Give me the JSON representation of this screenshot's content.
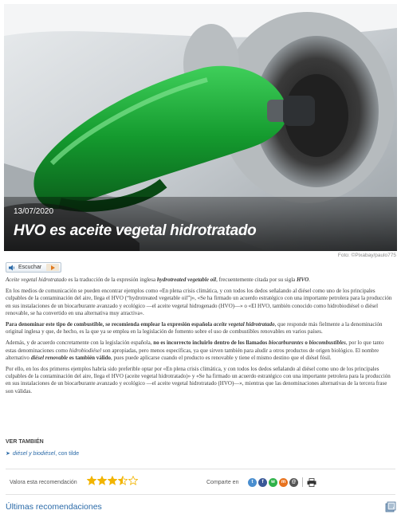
{
  "hero": {
    "date": "13/07/2020",
    "title": "HVO es aceite vegetal hidrotratado"
  },
  "image_credit": "Foto: ©Pixabay/paulo775",
  "listen": {
    "label": "Escuchar"
  },
  "article": {
    "p1": {
      "a": "Aceite vegetal hidrotratado",
      "b": " es la traducción de la expresión inglesa ",
      "c": "hydrotreated vegetable oil",
      "d": ", frecuentemente citada por su sigla ",
      "e": "HVO",
      "f": "."
    },
    "p2": "En los medios de comunicación se pueden encontrar ejemplos como «En plena crisis climática, y con todos los dedos señalando al diésel como uno de los principales culpables de la contaminación del aire, llega el HVO (“hydrotreated vegetable oil”)», «Se ha firmado un acuerdo estratégico con una importante petrolera para la producción en sus instalaciones de un biocarburante avanzado y ecológico —el aceite vegetal hidrogenado (HVO)—» o «El HVO, también conocido como hidrobiodiésel o diésel renovable, se ha convertido en una alternativa muy atractiva».",
    "p3": {
      "a": "Para denominar este tipo de combustible, se recomienda emplear la expresión española ",
      "b": "aceite vegetal hidrotratado",
      "c": ", que responde más fielmente a la denominación original inglesa y que, de hecho, es la que ya se emplea en la legislación de fomento sobre el uso de combustibles renovables en varios países."
    },
    "p4": {
      "a": "Además, y de acuerdo concretamente con la legislación española, ",
      "b": "no es incorrecto incluirlo dentro de los llamados ",
      "c": "biocarburantes",
      "d": " o ",
      "e": "biocombustibles",
      "f": ", por lo que tanto estas denominaciones como ",
      "g": "hidrobiodiésel",
      "h": " son apropiadas, pero menos específicas, ya que sirven también para aludir a otros productos de origen biológico. El nombre alternativo ",
      "i": "diésel renovable",
      "j": " es también válido",
      "k": ", pues puede aplicarse cuando el producto es renovable y tiene el mismo destino que el diésel fósil."
    },
    "p5": "Por ello, en los dos primeros ejemplos habría sido preferible optar por «En plena crisis climática, y con todos los dedos señalando al diésel como uno de los principales culpables de la contaminación del aire, llega el HVO (aceite vegetal hidrotratado)» y «Se ha firmado un acuerdo estratégico con una importante petrolera para la producción en sus instalaciones de un biocarburante avanzado y ecológico —el aceite vegetal hidrotratado (HVO)—», mientras que las denominaciones alternativas de la tercera frase son válidas."
  },
  "see_also": {
    "title": "VER TAMBIÉN",
    "link_italic": "diésel y biodiésel",
    "link_rest": ", con tilde"
  },
  "rating": {
    "label": "Valora esta recomendación",
    "value": 3.5,
    "max": 5,
    "color": "#f2b400"
  },
  "share": {
    "label": "Comparte en",
    "icons": [
      {
        "name": "twitter-icon",
        "glyph": "t",
        "color": "#4a8ecf"
      },
      {
        "name": "facebook-icon",
        "glyph": "f",
        "color": "#3b5998"
      },
      {
        "name": "whatsapp-icon",
        "glyph": "w",
        "color": "#2fb24a"
      },
      {
        "name": "meneame-icon",
        "glyph": "m",
        "color": "#e8731f"
      },
      {
        "name": "email-icon",
        "glyph": "@",
        "color": "#555555"
      }
    ]
  },
  "recommendations": {
    "title": "Últimas recomendaciones"
  }
}
